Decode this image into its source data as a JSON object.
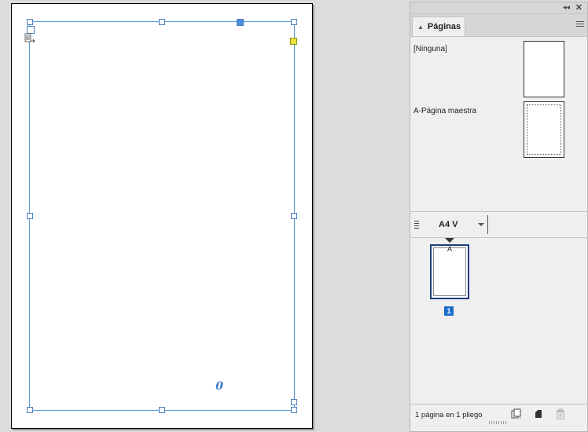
{
  "panel": {
    "tab_label": "Páginas",
    "collapse_glyph": "◂◂",
    "close_glyph": "✕",
    "masters": [
      {
        "label": "[Ninguna]"
      },
      {
        "label": "A-Página maestra"
      }
    ],
    "page_size": "A4 V",
    "pages": [
      {
        "prefix": "A",
        "number": "1"
      }
    ],
    "status": "1 página en 1 pliego"
  },
  "document": {
    "overset_glyph": "0"
  },
  "icons": {
    "tab_arrows": "up-down-arrows-icon",
    "panel_menu": "panel-menu-icon",
    "text_thread": "text-thread-icon",
    "edit_page_size": "edit-page-size-icon",
    "new_page": "new-page-icon",
    "delete": "trash-icon"
  },
  "colors": {
    "frame_blue": "#5b9bd5",
    "page_number_bg": "#1c6fc9",
    "yellow_handle": "#e8e23a"
  }
}
